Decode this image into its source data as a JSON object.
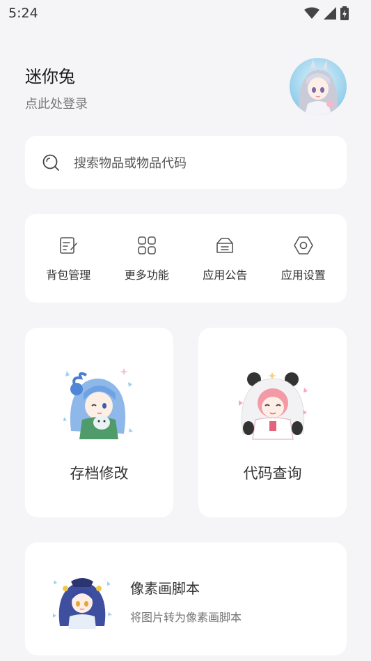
{
  "status_bar": {
    "time": "5:24"
  },
  "profile": {
    "name": "迷你兔",
    "login_prompt": "点此处登录"
  },
  "search": {
    "placeholder": "搜索物品或物品代码"
  },
  "functions": [
    {
      "label": "背包管理",
      "icon": "edit-doc-icon"
    },
    {
      "label": "更多功能",
      "icon": "grid-icon"
    },
    {
      "label": "应用公告",
      "icon": "inbox-icon"
    },
    {
      "label": "应用设置",
      "icon": "hexagon-settings-icon"
    }
  ],
  "cards": [
    {
      "title": "存档修改"
    },
    {
      "title": "代码查询"
    }
  ],
  "script_card": {
    "title": "像素画脚本",
    "subtitle": "将图片转为像素画脚本"
  },
  "colors": {
    "background": "#f5f5f7",
    "card": "#ffffff",
    "icon": "#555555"
  }
}
